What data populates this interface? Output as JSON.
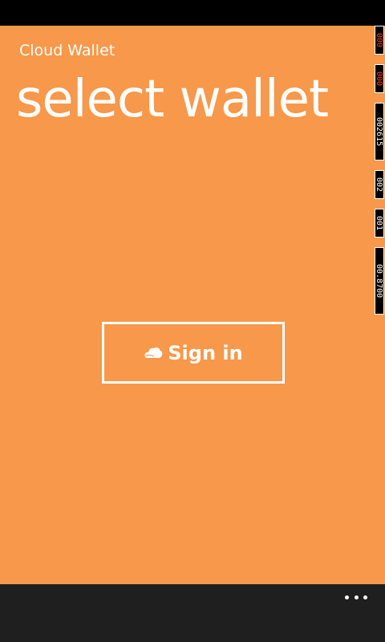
{
  "app": {
    "title": "Cloud Wallet",
    "page_title": "select wallet"
  },
  "signin": {
    "label": "Sign in",
    "icon": "cloud-icon"
  },
  "perf_counters": [
    "000",
    "000",
    "002615",
    "002",
    "001",
    "00.8700"
  ],
  "app_bar": {
    "more_icon": "ellipsis-icon"
  },
  "colors": {
    "accent": "#F7984B",
    "app_bar": "#1F1F1F",
    "foreground": "#FFFFFF"
  }
}
